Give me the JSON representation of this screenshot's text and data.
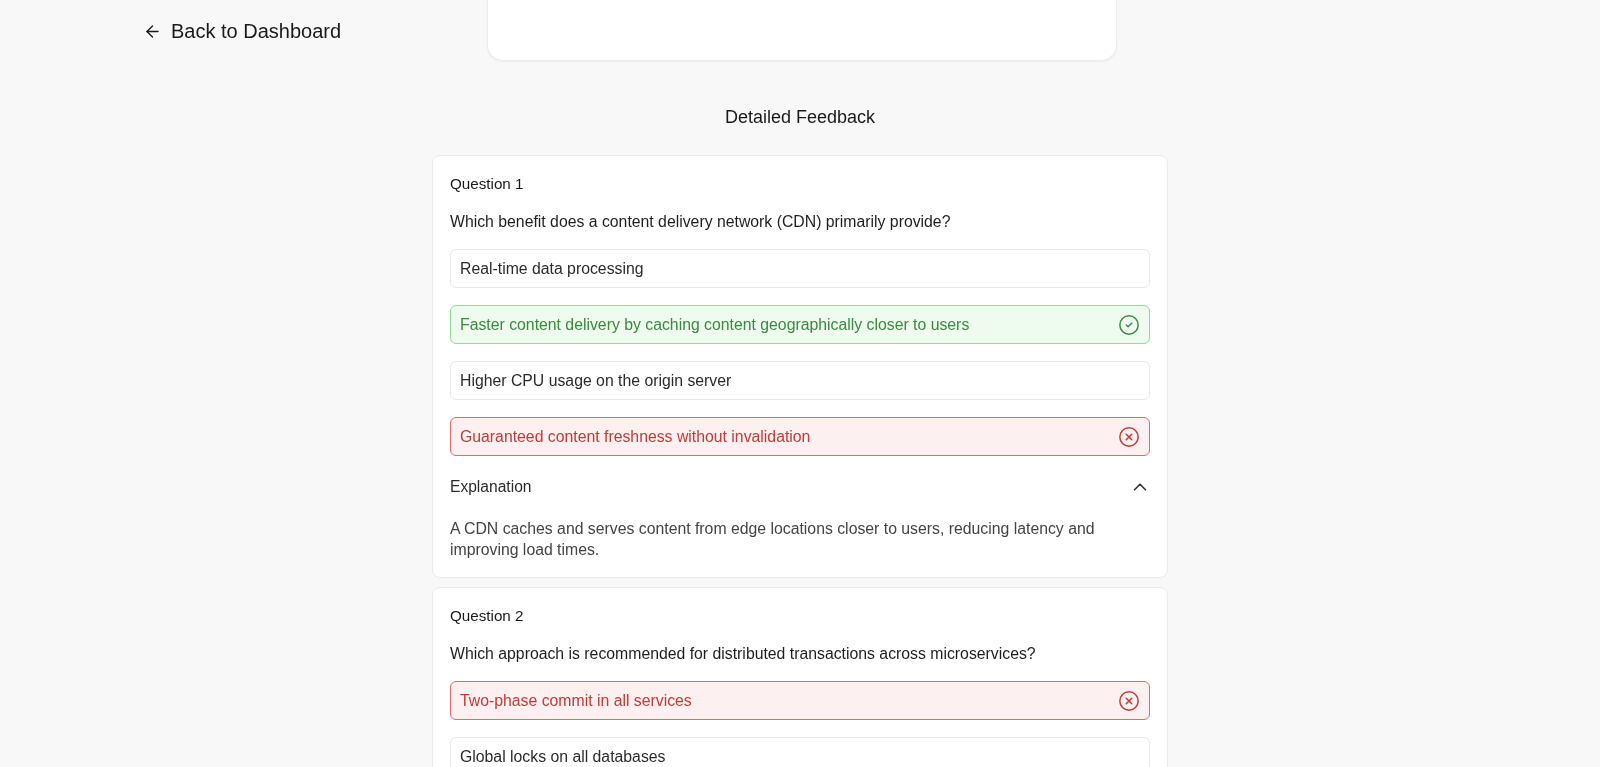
{
  "back_link": {
    "label": "Back to Dashboard"
  },
  "section_title": "Detailed Feedback",
  "questions": [
    {
      "title": "Question 1",
      "text": "Which benefit does a content delivery network (CDN) primarily provide?",
      "options": [
        {
          "label": "Real-time data processing",
          "selected": false,
          "correct": false
        },
        {
          "label": "Faster content delivery by caching content geographically closer to users",
          "selected": false,
          "correct": true
        },
        {
          "label": "Higher CPU usage on the origin server",
          "selected": false,
          "correct": false
        },
        {
          "label": "Guaranteed content freshness without invalidation",
          "selected": true,
          "correct": false
        }
      ],
      "explanation": {
        "title": "Explanation",
        "expanded": true,
        "text": "A CDN caches and serves content from edge locations closer to users, reducing latency and improving load times."
      }
    },
    {
      "title": "Question 2",
      "text": "Which approach is recommended for distributed transactions across microservices?",
      "options": [
        {
          "label": "Two-phase commit in all services",
          "selected": true,
          "correct": false
        },
        {
          "label": "Global locks on all databases",
          "selected": false,
          "correct": false
        }
      ]
    }
  ]
}
